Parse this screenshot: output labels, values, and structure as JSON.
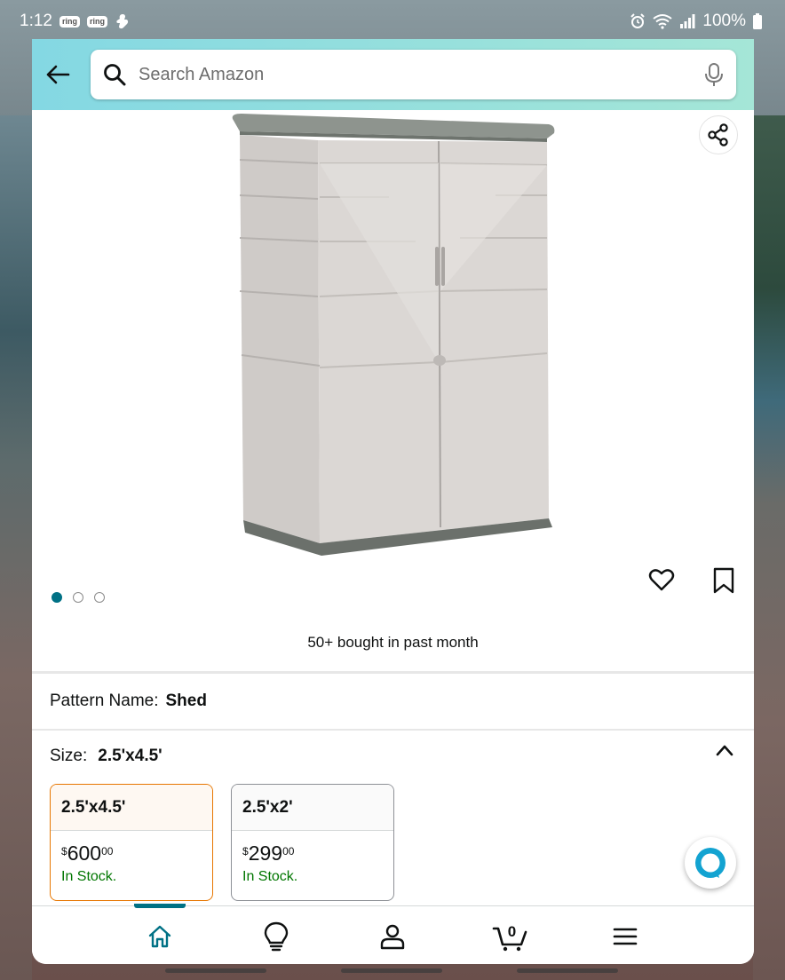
{
  "status_bar": {
    "time": "1:12",
    "ring_badge_1": "ring",
    "ring_badge_2": "ring",
    "battery": "100%"
  },
  "header": {
    "search_placeholder": "Search Amazon"
  },
  "product": {
    "image_count": 3,
    "active_image_index": 0,
    "bought_text": "50+ bought in past month"
  },
  "pattern": {
    "label": "Pattern Name:",
    "value": "Shed"
  },
  "size": {
    "label": "Size:",
    "value": "2.5'x4.5'",
    "options": [
      {
        "name": "2.5'x4.5'",
        "currency": "$",
        "whole": "600",
        "fraction": "00",
        "stock": "In Stock.",
        "selected": true
      },
      {
        "name": "2.5'x2'",
        "currency": "$",
        "whole": "299",
        "fraction": "00",
        "stock": "In Stock.",
        "selected": false
      }
    ]
  },
  "bottom_nav": {
    "cart_count": "0",
    "active": "home"
  },
  "colors": {
    "accent_teal": "#007185",
    "selected_orange": "#e77600",
    "stock_green": "#007600",
    "header_gradient_start": "#84d8e3",
    "header_gradient_end": "#a5e6d7"
  }
}
